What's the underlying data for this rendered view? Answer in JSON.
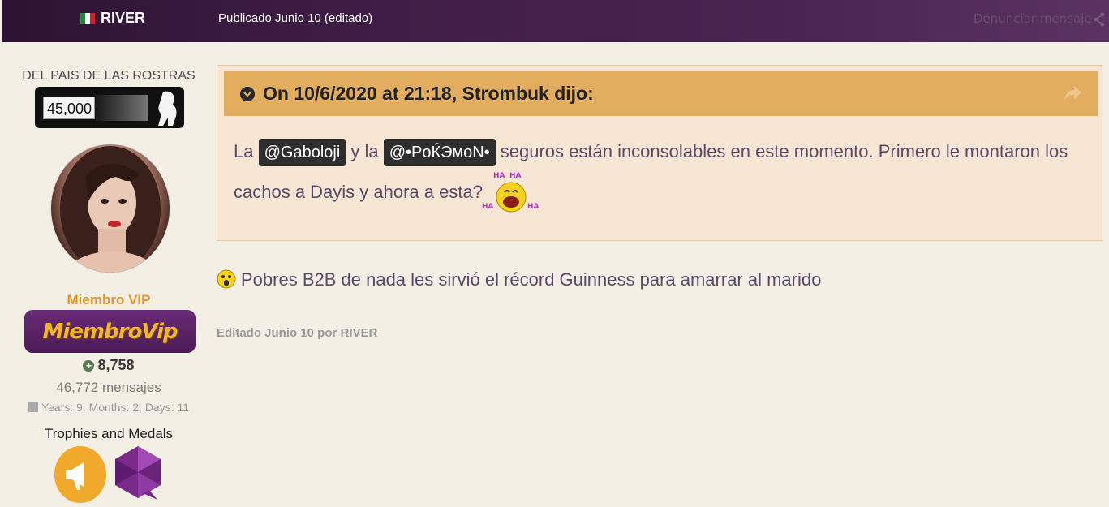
{
  "header": {
    "username": "RIVER",
    "published": "Publicado Junio 10 (editado)",
    "report_link": "Denunciar mensaje",
    "flag_icon": "mexico-flag-icon",
    "share_icon": "share-icon"
  },
  "profile": {
    "rank_title": "DEL PAIS DE LAS ROSTRAS",
    "rank_points": "45,000",
    "group_name": "Miembro VIP",
    "group_badge_text": "MiembroVip",
    "reputation": "8,758",
    "posts": "46,772 mensajes",
    "member_age": "Years: 9, Months: 2, Days: 11",
    "trophies_title": "Trophies and Medals"
  },
  "quote": {
    "citation": "On 10/6/2020 at 21:18, Strombuk dijo:",
    "line1_a": "La ",
    "mention_1": "@Gaboloji",
    "line1_b": " y la ",
    "mention_2": "@•PoЌЭмoN•",
    "line1_c": " seguros están inconsolables en este momento. Primero le montaron los",
    "line2": "cachos a Dayis y ahora a esta? ",
    "emoji_text": "HA HA HA HA"
  },
  "reply": {
    "text": "Pobres B2B de nada les sirvió el récord Guinness para amarrar al marido"
  },
  "edited": "Editado Junio 10 por RIVER",
  "colors": {
    "header_bg": "#3e1c44",
    "quote_header": "#e2ad5f",
    "quote_bg": "#f6e6d3",
    "vip_orange": "#e0962a",
    "vip_purple": "#5a2366"
  }
}
